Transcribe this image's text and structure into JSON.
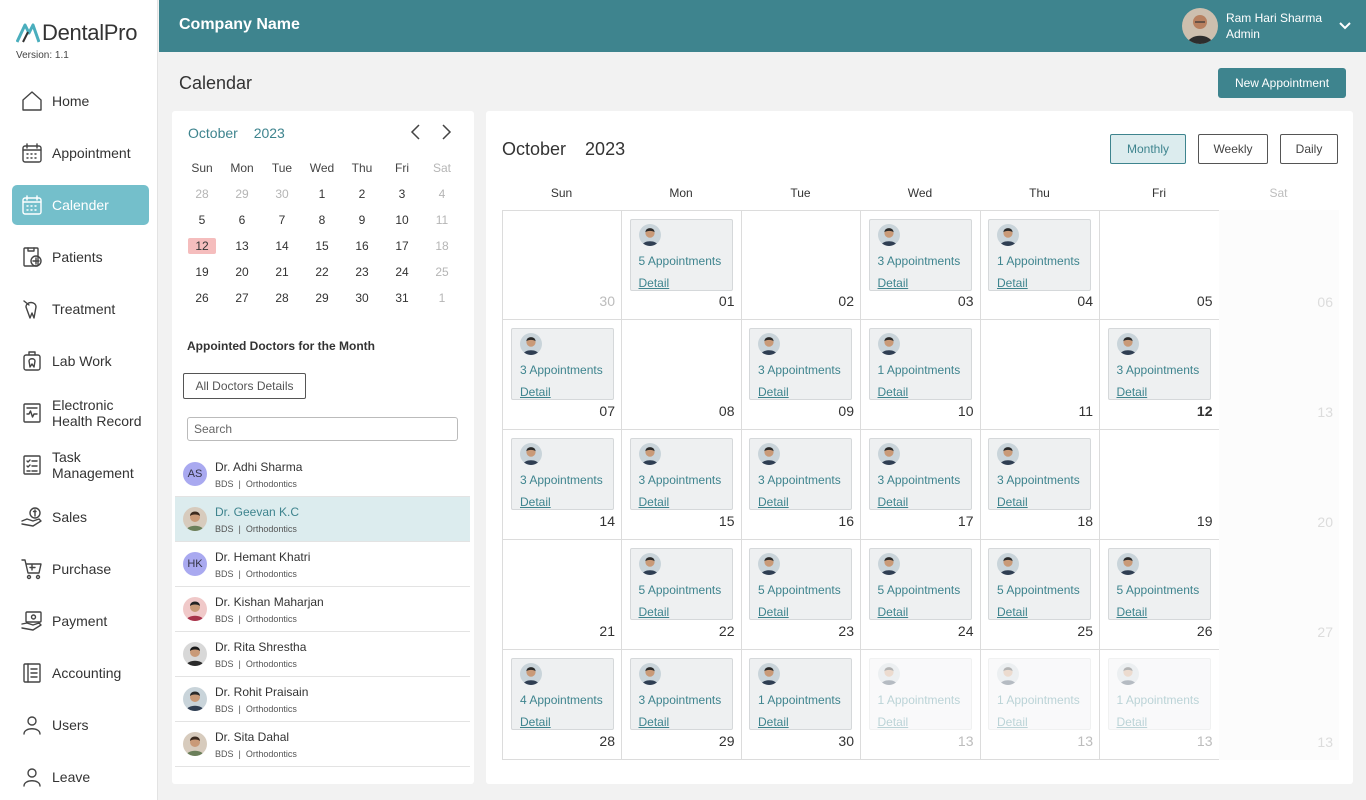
{
  "app": {
    "logo_text": "DentalPro",
    "version": "Version: 1.1"
  },
  "header": {
    "company": "Company Name",
    "user_name": "Ram Hari Sharma",
    "user_role": "Admin"
  },
  "sidebar": {
    "items": [
      {
        "label": "Home",
        "icon": "home-icon"
      },
      {
        "label": "Appointment",
        "icon": "appointment-icon"
      },
      {
        "label": "Calender",
        "icon": "calendar-icon",
        "active": true
      },
      {
        "label": "Patients",
        "icon": "patients-icon"
      },
      {
        "label": "Treatment",
        "icon": "treatment-icon"
      },
      {
        "label": "Lab Work",
        "icon": "lab-work-icon"
      },
      {
        "label": "Electronic\nHealth Record",
        "icon": "health-record-icon"
      },
      {
        "label": "Task\nManagement",
        "icon": "task-icon"
      },
      {
        "label": "Sales",
        "icon": "sales-icon"
      },
      {
        "label": "Purchase",
        "icon": "purchase-icon"
      },
      {
        "label": "Payment",
        "icon": "payment-icon"
      },
      {
        "label": "Accounting",
        "icon": "accounting-icon"
      },
      {
        "label": "Users",
        "icon": "users-icon"
      },
      {
        "label": "Leave",
        "icon": "leave-icon"
      }
    ]
  },
  "page": {
    "title": "Calendar",
    "new_appointment": "New Appointment"
  },
  "mini_calendar": {
    "month": "October",
    "year": "2023",
    "weekdays": [
      "Sun",
      "Mon",
      "Tue",
      "Wed",
      "Thu",
      "Fri",
      "Sat"
    ],
    "weeks": [
      [
        "28",
        "29",
        "30",
        "1",
        "2",
        "3",
        "4"
      ],
      [
        "5",
        "6",
        "7",
        "8",
        "9",
        "10",
        "11"
      ],
      [
        "12",
        "13",
        "14",
        "15",
        "16",
        "17",
        "18"
      ],
      [
        "19",
        "20",
        "21",
        "22",
        "23",
        "24",
        "25"
      ],
      [
        "26",
        "27",
        "28",
        "29",
        "30",
        "31",
        "1"
      ]
    ],
    "muted_days": [
      "0-0",
      "0-1",
      "0-2",
      "4-6"
    ],
    "today": "2-0"
  },
  "doctors": {
    "title": "Appointed Doctors for the Month",
    "all_details_label": "All Doctors Details",
    "search_placeholder": "Search",
    "list": [
      {
        "name": "Dr. Adhi Sharma",
        "degree": "BDS",
        "specialty": "Orthodontics",
        "initials": "AS",
        "color": "#a9a9f0"
      },
      {
        "name": "Dr. Geevan K.C",
        "degree": "BDS",
        "specialty": "Orthodontics",
        "photo": true,
        "selected": true
      },
      {
        "name": "Dr. Hemant Khatri",
        "degree": "BDS",
        "specialty": "Orthodontics",
        "initials": "HK",
        "color": "#a9a9f0"
      },
      {
        "name": "Dr. Kishan Maharjan",
        "degree": "BDS",
        "specialty": "Orthodontics",
        "photo": true
      },
      {
        "name": "Dr. Rita Shrestha",
        "degree": "BDS",
        "specialty": "Orthodontics",
        "photo": true
      },
      {
        "name": "Dr. Rohit Praisain",
        "degree": "BDS",
        "specialty": "Orthodontics",
        "photo": true
      },
      {
        "name": "Dr. Sita Dahal",
        "degree": "BDS",
        "specialty": "Orthodontics",
        "photo": true
      }
    ]
  },
  "calendar": {
    "month": "October",
    "year": "2023",
    "views": [
      "Monthly",
      "Weekly",
      "Daily"
    ],
    "active_view": "Monthly",
    "weekdays": [
      "Sun",
      "Mon",
      "Tue",
      "Wed",
      "Thu",
      "Fri",
      "Sat"
    ],
    "weeks": [
      [
        {
          "day": "30",
          "muted": true
        },
        {
          "day": "01",
          "count": "5 Appointments"
        },
        {
          "day": "02"
        },
        {
          "day": "03",
          "count": "3 Appointments"
        },
        {
          "day": "04",
          "count": "1 Appointments"
        },
        {
          "day": "05"
        },
        {
          "day": "06"
        }
      ],
      [
        {
          "day": "07",
          "count": "3 Appointments"
        },
        {
          "day": "08"
        },
        {
          "day": "09",
          "count": "3 Appointments"
        },
        {
          "day": "10",
          "count": "1 Appointments"
        },
        {
          "day": "11"
        },
        {
          "day": "12",
          "count": "3 Appointments",
          "bold": true
        },
        {
          "day": "13"
        }
      ],
      [
        {
          "day": "14",
          "count": "3 Appointments"
        },
        {
          "day": "15",
          "count": "3 Appointments"
        },
        {
          "day": "16",
          "count": "3 Appointments"
        },
        {
          "day": "17",
          "count": "3 Appointments"
        },
        {
          "day": "18",
          "count": "3 Appointments"
        },
        {
          "day": "19"
        },
        {
          "day": "20"
        }
      ],
      [
        {
          "day": "21"
        },
        {
          "day": "22",
          "count": "5 Appointments"
        },
        {
          "day": "23",
          "count": "5 Appointments"
        },
        {
          "day": "24",
          "count": "5 Appointments"
        },
        {
          "day": "25",
          "count": "5 Appointments"
        },
        {
          "day": "26",
          "count": "5 Appointments"
        },
        {
          "day": "27"
        }
      ],
      [
        {
          "day": "28",
          "count": "4 Appointments"
        },
        {
          "day": "29",
          "count": "3 Appointments"
        },
        {
          "day": "30",
          "count": "1 Appointments"
        },
        {
          "day": "13",
          "count": "1 Appointments",
          "faded": true
        },
        {
          "day": "13",
          "count": "1 Appointments",
          "faded": true
        },
        {
          "day": "13",
          "count": "1 Appointments",
          "faded": true
        },
        {
          "day": "13"
        }
      ]
    ],
    "detail_label": "Detail"
  },
  "colors": {
    "primary": "#3e848e",
    "active_nav": "#74bfcb",
    "today_highlight": "#f5bdbd"
  }
}
